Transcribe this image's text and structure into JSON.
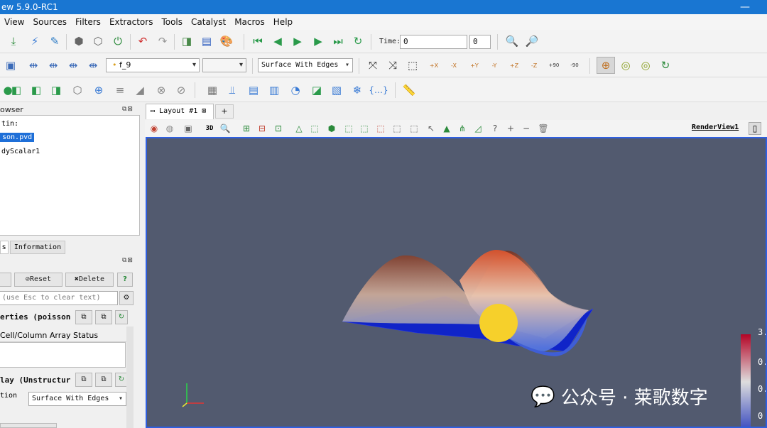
{
  "window": {
    "title": "ew 5.9.0-RC1",
    "controls": "—"
  },
  "menu": [
    "View",
    "Sources",
    "Filters",
    "Extractors",
    "Tools",
    "Catalyst",
    "Macros",
    "Help"
  ],
  "time": {
    "label": "Time:",
    "value": "0",
    "index": "0"
  },
  "toolbar2": {
    "array_select": "f_9",
    "representation": "Surface With Edges"
  },
  "camera_labels": [
    "+X",
    "-X",
    "+Y",
    "-Y",
    "+Z",
    "-Z",
    "+90",
    "-90"
  ],
  "pipeline": {
    "title": "owser",
    "builtin": "tin:",
    "items": [
      "son.pvd",
      "dyScalar1"
    ]
  },
  "properties": {
    "tabs": [
      "s",
      "Information"
    ],
    "reset_label": "Reset",
    "delete_label": "Delete",
    "help_label": "?",
    "search_placeholder": "(use Esc to clear text)",
    "section1": "erties (poisson",
    "array_status": "Cell/Column Array Status",
    "section2": "lay (Unstructur",
    "repr_label": "tion",
    "repr_value": "Surface With Edges"
  },
  "layout": {
    "tab": "Layout #1",
    "plus": "+",
    "view_label": "RenderView1",
    "mode3d": "3D"
  },
  "colorbar": {
    "labels": [
      "3.",
      "0.",
      "0.",
      "0"
    ]
  },
  "watermark": "公众号 · 莱歌数字",
  "colors": {
    "accent": "#1976d2",
    "render_bg": "#525a6f",
    "view_border": "#2f5fe0"
  }
}
